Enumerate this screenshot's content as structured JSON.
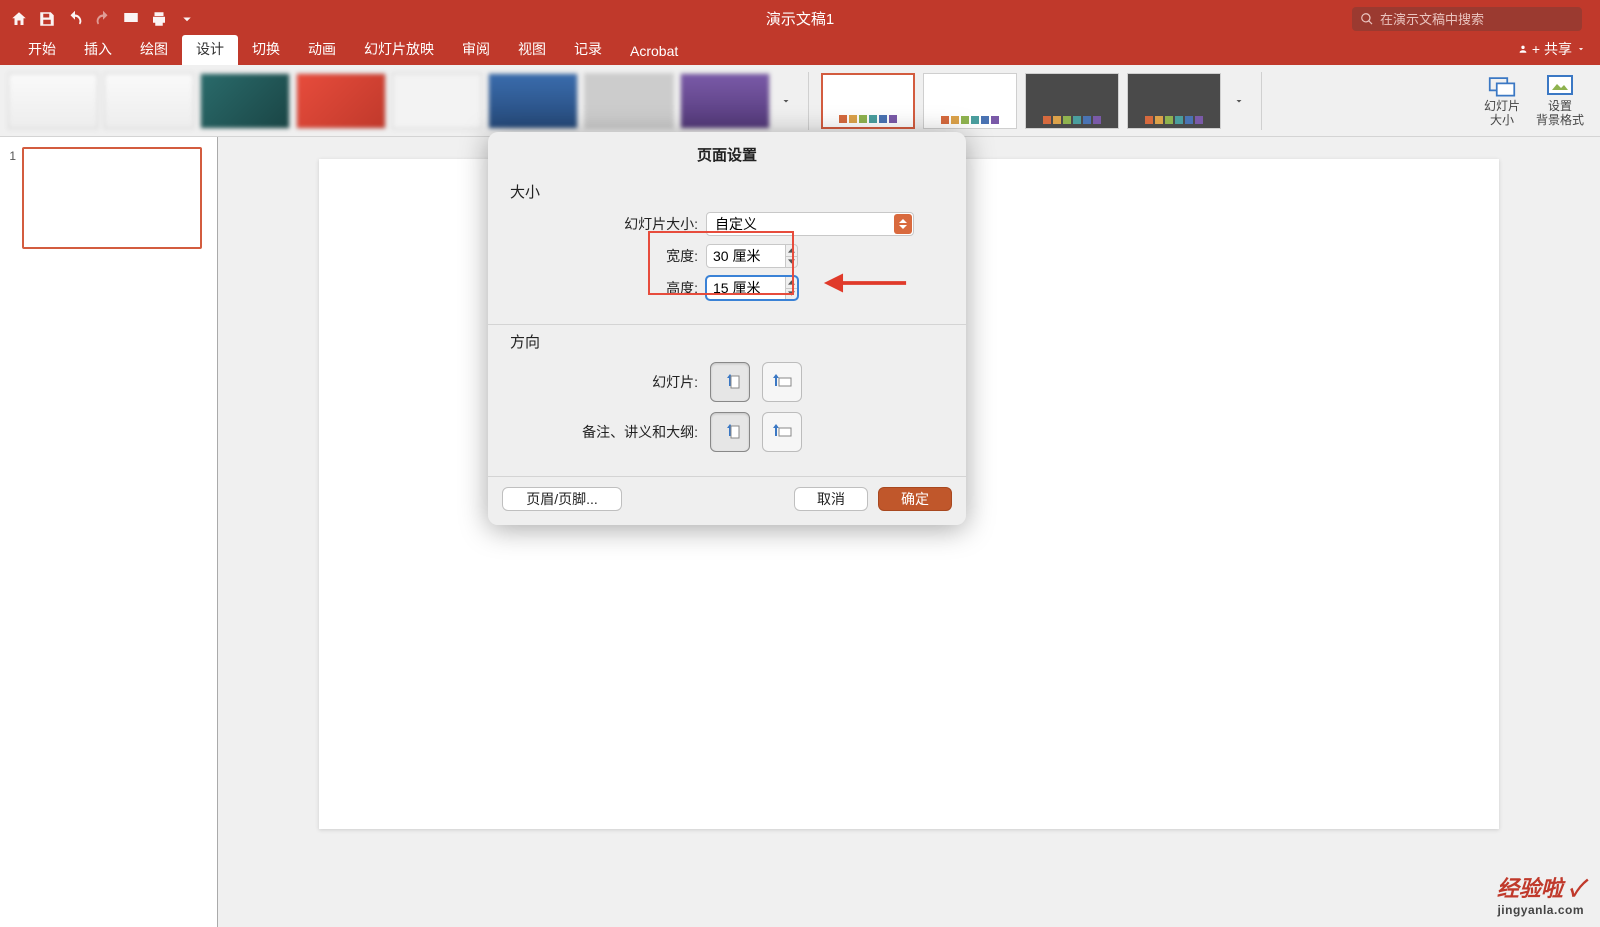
{
  "app": {
    "title": "演示文稿1",
    "search_placeholder": "在演示文稿中搜索",
    "share_label": "共享"
  },
  "tabs": {
    "home": "开始",
    "insert": "插入",
    "draw": "绘图",
    "design": "设计",
    "transitions": "切换",
    "animations": "动画",
    "slideshow": "幻灯片放映",
    "review": "审阅",
    "view": "视图",
    "record": "记录",
    "acrobat": "Acrobat"
  },
  "ribbon": {
    "slide_size": "幻灯片\n大小",
    "format_bg": "设置\n背景格式"
  },
  "thumbs": {
    "n1": "1"
  },
  "dialog": {
    "title": "页面设置",
    "size_section": "大小",
    "slide_size_label": "幻灯片大小:",
    "slide_size_value": "自定义",
    "width_label": "宽度:",
    "width_value": "30 厘米",
    "height_label": "高度:",
    "height_value": "15 厘米",
    "orient_section": "方向",
    "slide_orient_label": "幻灯片:",
    "notes_orient_label": "备注、讲义和大纲:",
    "header_footer_btn": "页眉/页脚...",
    "cancel_btn": "取消",
    "ok_btn": "确定"
  },
  "watermark": {
    "line1": "经验啦",
    "line2": "jingyanla.com"
  }
}
